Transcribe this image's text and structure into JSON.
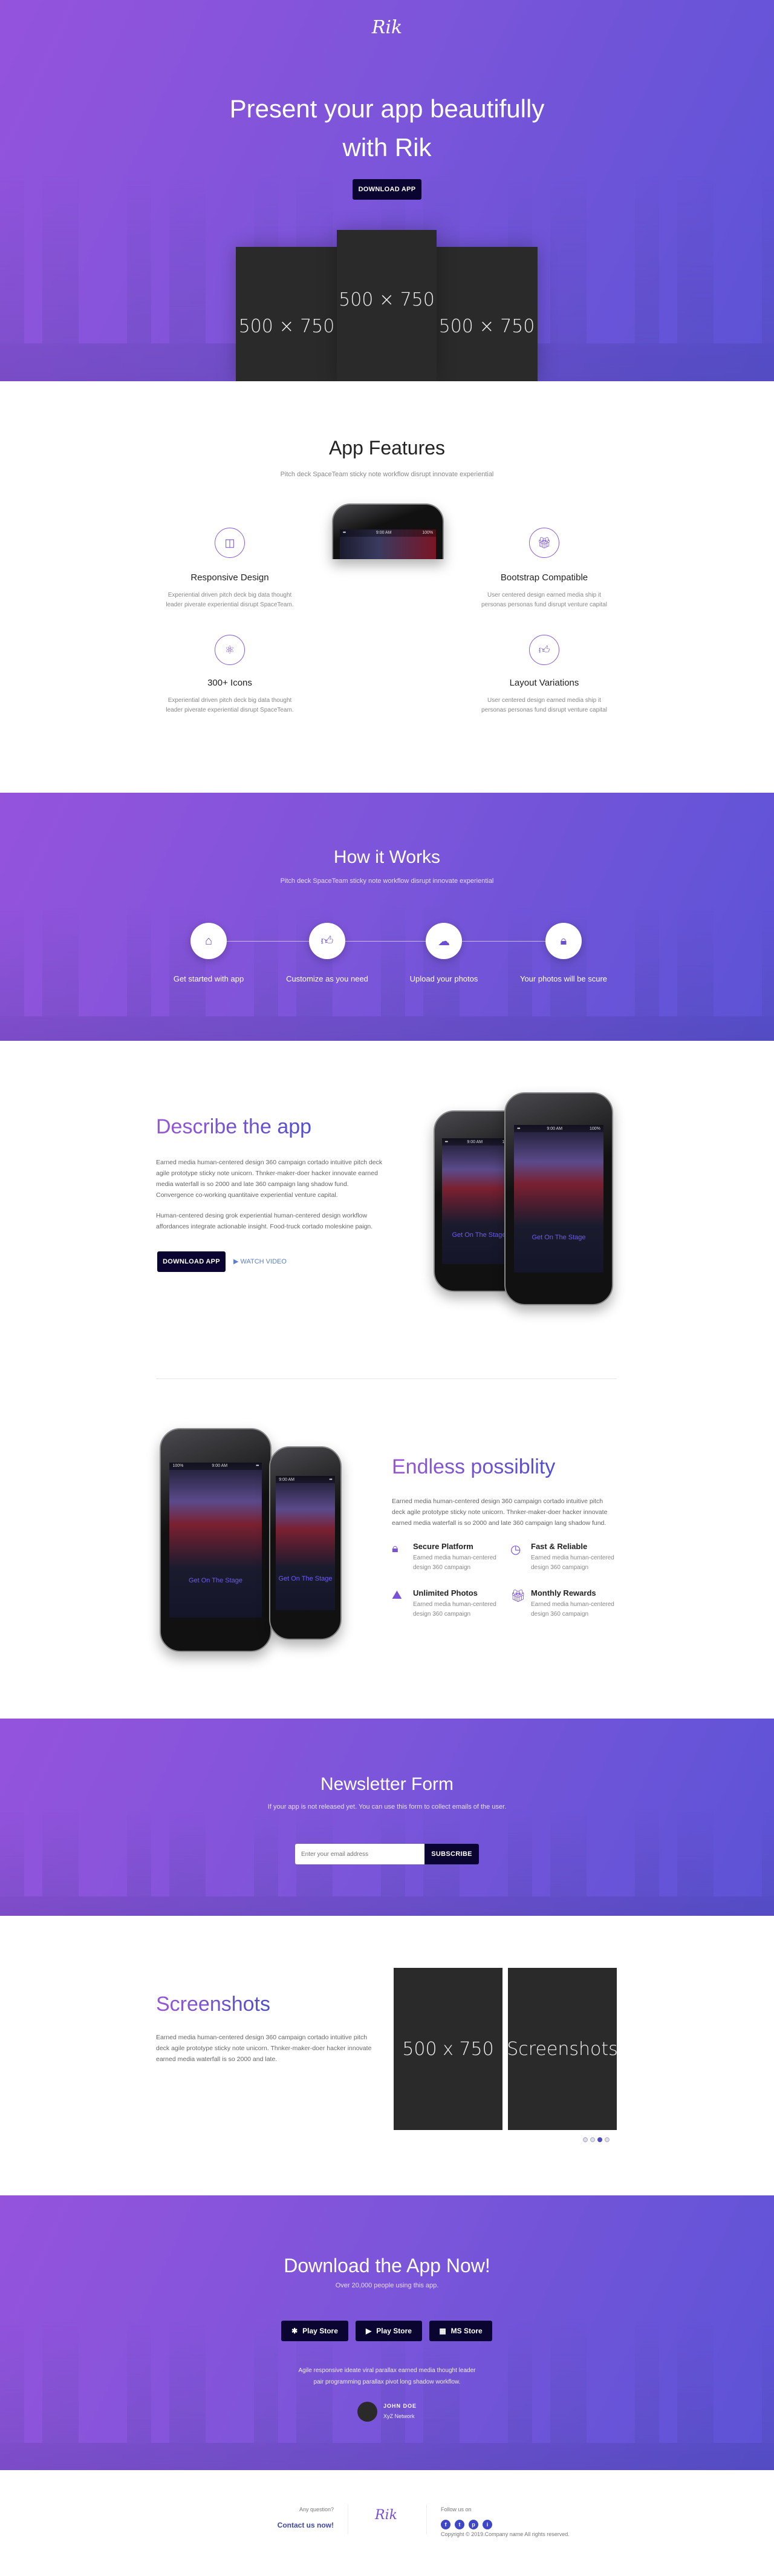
{
  "colors": {
    "accent": "#6b52d6",
    "button": "#0a0530",
    "social": "#3f47c9"
  },
  "hero": {
    "logo": "Rik",
    "title_line1": "Present your app beautifully",
    "title_line2": "with Rik",
    "cta": "DOWNLOAD APP",
    "placeholders": [
      "500 × 750",
      "500 × 750",
      "500 × 750"
    ]
  },
  "features": {
    "title": "App Features",
    "subtitle": "Pitch deck SpaceTeam sticky note workflow disrupt innovate experiential",
    "items": [
      {
        "icon": "map-icon",
        "title": "Responsive Design",
        "desc": "Experiential driven pitch deck big data thought leader piverate experiential disrupt SpaceTeam."
      },
      {
        "icon": "gift-icon",
        "title": "Bootstrap Compatible",
        "desc": "User centered design earned media ship it personas personas fund disrupt venture capital"
      },
      {
        "icon": "atom-icon",
        "title": "300+ Icons",
        "desc": "Experiential driven pitch deck big data thought leader piverate experiential disrupt SpaceTeam."
      },
      {
        "icon": "thumbs-up-icon",
        "title": "Layout Variations",
        "desc": "User centered design earned media ship it personas personas fund disrupt venture capital"
      }
    ]
  },
  "how": {
    "title": "How it Works",
    "subtitle": "Pitch deck SpaceTeam sticky note workflow disrupt innovate experiential",
    "steps": [
      {
        "icon": "home-icon",
        "label": "Get started with app"
      },
      {
        "icon": "thumbs-up-icon",
        "label": "Customize as you need"
      },
      {
        "icon": "cloud-download-icon",
        "label": "Upload your photos"
      },
      {
        "icon": "lock-icon",
        "label": "Your photos will be scure"
      }
    ]
  },
  "describe": {
    "title": "Describe the app",
    "p1": "Earned media human-centered design 360 campaign cortado intuitive pitch deck agile prototype sticky note unicorn. Thnker-maker-doer hacker innovate earned media waterfall is so 2000 and late 360 campaign lang shadow fund. Convergence co-working quantitaive experiential venture capital.",
    "p2": "Human-centered desing grok experiential human-centered design workflow affordances integrate actionable insight. Food-truck cortado moleskine paign.",
    "cta": "DOWNLOAD APP",
    "video": "WATCH VIDEO"
  },
  "phone": {
    "time": "9:00 AM",
    "battery": "100%",
    "caption": "Get On The Stage"
  },
  "endless": {
    "title": "Endless possiblity",
    "p": "Earned media human-centered design 360 campaign cortado intuitive pitch deck agile prototype sticky note unicorn. Thnker-maker-doer hacker innovate earned media waterfall is so 2000 and late 360 campaign lang shadow fund.",
    "items": [
      {
        "icon": "lock-icon",
        "title": "Secure Platform",
        "desc": "Earned media human-centered design 360 campaign"
      },
      {
        "icon": "clock-icon",
        "title": "Fast & Reliable",
        "desc": "Earned media human-centered design 360 campaign"
      },
      {
        "icon": "image-icon",
        "title": "Unlimited Photos",
        "desc": "Earned media human-centered design 360 campaign"
      },
      {
        "icon": "gift-icon",
        "title": "Monthly Rewards",
        "desc": "Earned media human-centered design 360 campaign"
      }
    ]
  },
  "newsletter": {
    "title": "Newsletter Form",
    "subtitle": "If your app is not released yet. You can use this form to collect emails of the user.",
    "placeholder": "Enter your email address",
    "button": "SUBSCRIBE"
  },
  "screenshots": {
    "title": "Screenshots",
    "p": "Earned media human-centered design 360 campaign cortado intuitive pitch deck agile prototype sticky note unicorn. Thnker-maker-doer hacker innovate earned media waterfall is so 2000 and late.",
    "slides": [
      "500 x 750",
      "Screenshots"
    ],
    "dots": 4,
    "active_dot": 3
  },
  "download": {
    "title": "Download the App Now!",
    "subtitle": "Over 20,000 people using this app.",
    "stores": [
      {
        "icon": "app-store-icon",
        "label": "Play Store"
      },
      {
        "icon": "play-store-icon",
        "label": "Play Store"
      },
      {
        "icon": "windows-icon",
        "label": "MS Store"
      }
    ],
    "quote": "Agile responsive ideate viral parallax earned media thought leader pair programming parallax pivot long shadow workflow.",
    "name": "JOHN DOE",
    "company": "XyZ Network"
  },
  "footer": {
    "question": "Any question?",
    "contact": "Contact us now!",
    "logo": "Rik",
    "follow": "Follow us on",
    "social": [
      "f",
      "t",
      "p",
      "i"
    ],
    "copyright": "Copyright © 2019.Company name All rights reserved."
  }
}
